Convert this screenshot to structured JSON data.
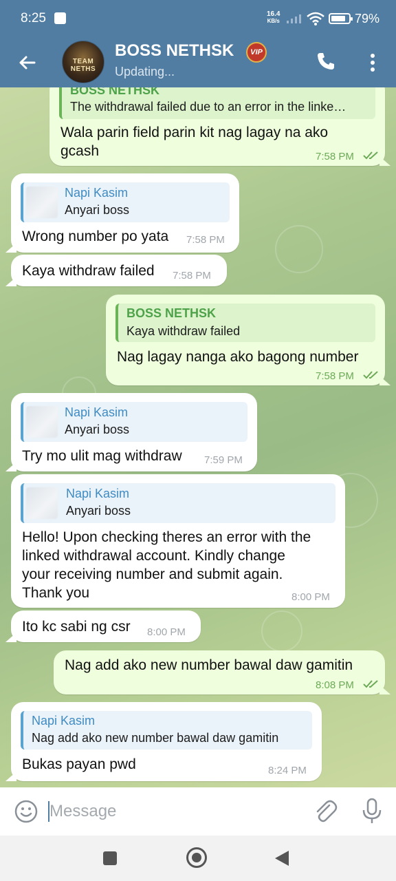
{
  "status_bar": {
    "time": "8:25",
    "net_speed": "16.4",
    "net_unit": "KB/s",
    "battery": "79%"
  },
  "header": {
    "title": "BOSS NETHSK",
    "badge": "VIP",
    "subtitle": "Updating...",
    "avatar_text": "TEAM NETHS"
  },
  "messages": [
    {
      "dir": "out",
      "reply": {
        "name": "BOSS NETHSK",
        "text": "The withdrawal failed due to an error in the linke…"
      },
      "text": "Wala parin field parin kit nag lagay na ako gcash",
      "time": "7:58 PM"
    },
    {
      "dir": "in",
      "reply": {
        "name": "Napi Kasim",
        "text": "Anyari boss"
      },
      "text": "Wrong number po yata",
      "time": "7:58 PM"
    },
    {
      "dir": "in",
      "text": "Kaya withdraw failed",
      "time": "7:58 PM"
    },
    {
      "dir": "out",
      "reply": {
        "name": "BOSS NETHSK",
        "text": "Kaya withdraw failed"
      },
      "text": "Nag lagay nanga ako bagong number",
      "time": "7:58 PM"
    },
    {
      "dir": "in",
      "reply": {
        "name": "Napi Kasim",
        "text": "Anyari boss"
      },
      "text": "Try mo ulit mag withdraw",
      "time": "7:59 PM"
    },
    {
      "dir": "in",
      "reply": {
        "name": "Napi Kasim",
        "text": "Anyari boss"
      },
      "text_lines": [
        "Hello! Upon checking theres an error with the",
        "linked withdrawal account. Kindly change",
        "your receiving number and submit again.",
        "Thank you"
      ],
      "time": "8:00 PM"
    },
    {
      "dir": "in",
      "text": "Ito kc sabi ng csr",
      "time": "8:00 PM"
    },
    {
      "dir": "out",
      "text": "Nag add ako new number bawal daw gamitin",
      "time": "8:08 PM"
    },
    {
      "dir": "in",
      "reply": {
        "name": "Napi Kasim",
        "text": "Nag add ako new number bawal daw gamitin"
      },
      "text": "Bukas payan pwd",
      "time": "8:24 PM"
    }
  ],
  "composer": {
    "placeholder": "Message"
  },
  "colors": {
    "header": "#517da2",
    "bubble_out": "#effedd",
    "bubble_in": "#ffffff",
    "reply_name_in": "#3f8bc2",
    "reply_name_out": "#4ea24a"
  },
  "icons": [
    "back-arrow-icon",
    "phone-icon",
    "more-vert-icon",
    "emoji-icon",
    "paperclip-icon",
    "mic-icon",
    "double-check-icon"
  ]
}
